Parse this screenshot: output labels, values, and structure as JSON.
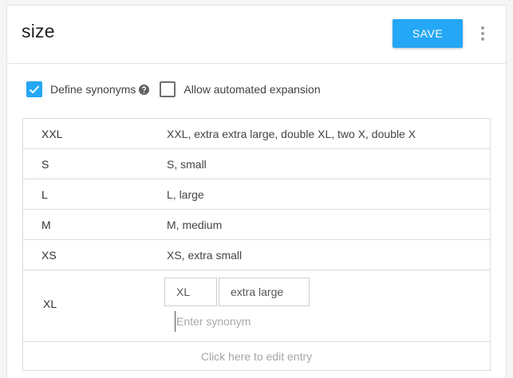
{
  "entity": {
    "title": "size"
  },
  "toolbar": {
    "save_label": "SAVE",
    "more_icon": "more-vert-icon"
  },
  "options": {
    "define_synonyms": {
      "label": "Define synonyms",
      "checked": true
    },
    "allow_expansion": {
      "label": "Allow automated expansion",
      "checked": false
    }
  },
  "entries": [
    {
      "value": "XXL",
      "synonyms": "XXL, extra extra large, double XL, two X, double X"
    },
    {
      "value": "S",
      "synonyms": "S, small"
    },
    {
      "value": "L",
      "synonyms": "L, large"
    },
    {
      "value": "M",
      "synonyms": "M, medium"
    },
    {
      "value": "XS",
      "synonyms": "XS, extra small"
    }
  ],
  "editing_entry": {
    "value": "XL",
    "synonym_chips": [
      "XL",
      "extra large"
    ],
    "input_placeholder": "Enter synonym"
  },
  "edit_link": "Click here to edit entry",
  "colors": {
    "accent": "#24a7f5",
    "border": "#dcdcdc"
  }
}
